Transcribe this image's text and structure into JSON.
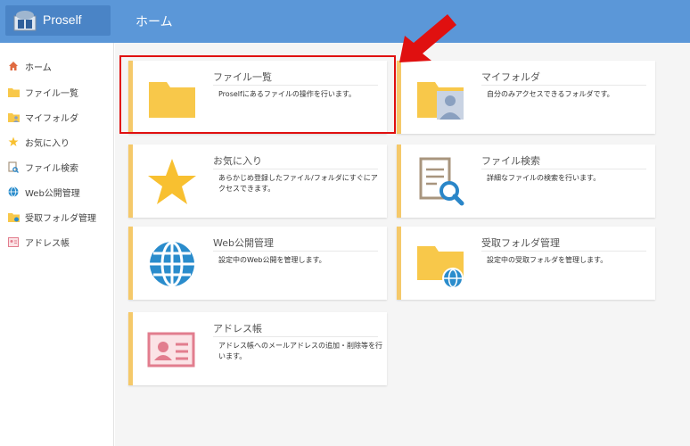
{
  "app": {
    "logo_text": "Proself",
    "header_title": "ホーム"
  },
  "sidebar": {
    "items": [
      {
        "label": "ホーム",
        "icon": "home-icon",
        "active": true
      },
      {
        "label": "ファイル一覧",
        "icon": "folder-icon"
      },
      {
        "label": "マイフォルダ",
        "icon": "my-folder-icon"
      },
      {
        "label": "お気に入り",
        "icon": "star-icon"
      },
      {
        "label": "ファイル検索",
        "icon": "file-search-icon"
      },
      {
        "label": "Web公開管理",
        "icon": "globe-icon"
      },
      {
        "label": "受取フォルダ管理",
        "icon": "receive-folder-icon"
      },
      {
        "label": "アドレス帳",
        "icon": "address-book-icon"
      }
    ]
  },
  "cards": [
    {
      "title": "ファイル一覧",
      "desc": "Proselfにあるファイルの操作を行います。",
      "icon": "folder-icon"
    },
    {
      "title": "マイフォルダ",
      "desc": "自分のみアクセスできるフォルダです。",
      "icon": "my-folder-icon"
    },
    {
      "title": "お気に入り",
      "desc": "あらかじめ登録したファイル/フォルダにすぐにアクセスできます。",
      "icon": "star-icon"
    },
    {
      "title": "ファイル検索",
      "desc": "詳細なファイルの検索を行います。",
      "icon": "file-search-icon"
    },
    {
      "title": "Web公開管理",
      "desc": "設定中のWeb公開を管理します。",
      "icon": "globe-icon"
    },
    {
      "title": "受取フォルダ管理",
      "desc": "設定中の受取フォルダを管理します。",
      "icon": "receive-folder-icon"
    },
    {
      "title": "アドレス帳",
      "desc": "アドレス帳へのメールアドレスの追加・削除等を行います。",
      "icon": "address-book-icon"
    }
  ],
  "colors": {
    "header": "#5b97d8",
    "card_accent": "#f5c96a",
    "folder": "#f8c84a",
    "highlight": "#e01010"
  }
}
